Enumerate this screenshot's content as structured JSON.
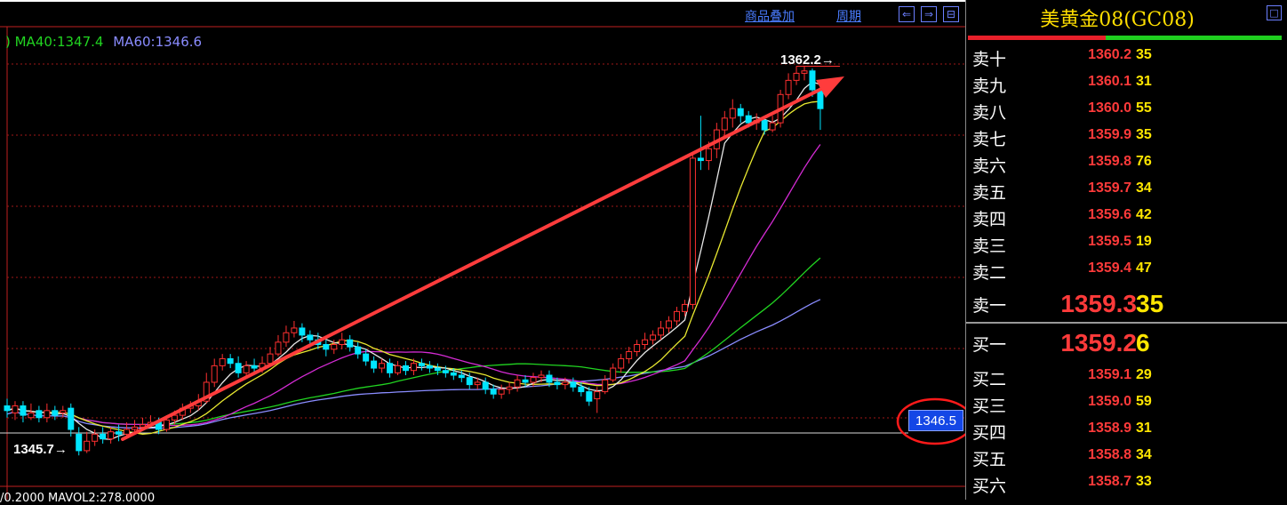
{
  "toolbar": {
    "overlay_label": "商品叠加",
    "period_label": "周期",
    "nav_buttons": [
      "⇐",
      "⇒",
      "⊟"
    ]
  },
  "ma_legend": [
    {
      "text": ") MA40:1347.4",
      "color": "#21d421"
    },
    {
      "text": "MA60:1346.6",
      "color": "#8a8cff"
    }
  ],
  "labels": {
    "high_price": "1362.2",
    "low_price": "1345.7",
    "cursor_price": "1346.5",
    "volume_line": "/0.2000  MAVOL2:278.0000"
  },
  "quote": {
    "title": "美黄金08(GC08)",
    "sell": [
      {
        "label": "卖十",
        "price": "1360.2",
        "vol": "35"
      },
      {
        "label": "卖九",
        "price": "1360.1",
        "vol": "31"
      },
      {
        "label": "卖八",
        "price": "1360.0",
        "vol": "55"
      },
      {
        "label": "卖七",
        "price": "1359.9",
        "vol": "35"
      },
      {
        "label": "卖六",
        "price": "1359.8",
        "vol": "76"
      },
      {
        "label": "卖五",
        "price": "1359.7",
        "vol": "34"
      },
      {
        "label": "卖四",
        "price": "1359.6",
        "vol": "42"
      },
      {
        "label": "卖三",
        "price": "1359.5",
        "vol": "19"
      },
      {
        "label": "卖二",
        "price": "1359.4",
        "vol": "47"
      },
      {
        "label": "卖一",
        "price": "1359.3",
        "vol": "35"
      }
    ],
    "buy": [
      {
        "label": "买一",
        "price": "1359.2",
        "vol": "6"
      },
      {
        "label": "买二",
        "price": "1359.1",
        "vol": "29"
      },
      {
        "label": "买三",
        "price": "1359.0",
        "vol": "59"
      },
      {
        "label": "买四",
        "price": "1358.9",
        "vol": "31"
      },
      {
        "label": "买五",
        "price": "1358.8",
        "vol": "34"
      },
      {
        "label": "买六",
        "price": "1358.7",
        "vol": "33"
      }
    ]
  },
  "colors": {
    "up": "#ff3030",
    "down": "#00e5ff",
    "ma5": "#e8e8e8",
    "ma10": "#e8e830",
    "ma20": "#d42bd4",
    "ma40": "#21d421",
    "ma60": "#8a8cff",
    "arrow": "#ff3c3c"
  },
  "chart_data": {
    "type": "candlestick",
    "price_range": [
      1344.2,
      1363.8
    ],
    "high": 1362.2,
    "low": 1345.7,
    "candles": [
      [
        1347.8,
        1347.6,
        1348.1,
        1347.3
      ],
      [
        1347.5,
        1347.8,
        1348.0,
        1347.2
      ],
      [
        1347.8,
        1347.4,
        1348.0,
        1347.1
      ],
      [
        1347.3,
        1347.5,
        1347.9,
        1347.2
      ],
      [
        1347.6,
        1347.3,
        1347.8,
        1347.1
      ],
      [
        1347.3,
        1347.6,
        1347.9,
        1347.1
      ],
      [
        1347.6,
        1347.4,
        1347.8,
        1347.2
      ],
      [
        1347.5,
        1347.6,
        1347.8,
        1347.3
      ],
      [
        1347.7,
        1346.8,
        1347.9,
        1346.5
      ],
      [
        1346.6,
        1345.9,
        1346.9,
        1345.7
      ],
      [
        1345.9,
        1346.3,
        1346.7,
        1345.8
      ],
      [
        1346.3,
        1346.6,
        1346.8,
        1346.1
      ],
      [
        1346.6,
        1346.4,
        1346.9,
        1346.2
      ],
      [
        1346.4,
        1346.7,
        1346.9,
        1346.2
      ],
      [
        1346.7,
        1346.6,
        1347.0,
        1346.3
      ],
      [
        1346.6,
        1346.8,
        1347.1,
        1346.4
      ],
      [
        1346.8,
        1346.9,
        1347.2,
        1346.6
      ],
      [
        1346.9,
        1347.0,
        1347.3,
        1346.8
      ],
      [
        1347.0,
        1347.1,
        1347.4,
        1346.9
      ],
      [
        1347.1,
        1346.8,
        1347.3,
        1346.6
      ],
      [
        1346.8,
        1347.2,
        1347.4,
        1346.7
      ],
      [
        1347.2,
        1347.4,
        1347.6,
        1347.0
      ],
      [
        1347.4,
        1347.7,
        1347.9,
        1347.2
      ],
      [
        1347.7,
        1347.8,
        1348.0,
        1347.5
      ],
      [
        1347.8,
        1348.0,
        1348.3,
        1347.6
      ],
      [
        1348.0,
        1348.8,
        1349.2,
        1347.9
      ],
      [
        1348.8,
        1349.5,
        1349.8,
        1348.6
      ],
      [
        1349.5,
        1349.8,
        1350.0,
        1349.3
      ],
      [
        1349.8,
        1349.6,
        1350.0,
        1349.4
      ],
      [
        1349.6,
        1349.2,
        1349.9,
        1349.0
      ],
      [
        1349.2,
        1349.5,
        1349.7,
        1349.0
      ],
      [
        1349.5,
        1349.4,
        1349.8,
        1349.2
      ],
      [
        1349.4,
        1349.6,
        1349.9,
        1349.2
      ],
      [
        1349.6,
        1350.0,
        1350.3,
        1349.5
      ],
      [
        1350.0,
        1350.5,
        1350.8,
        1349.9
      ],
      [
        1350.5,
        1350.9,
        1351.2,
        1350.3
      ],
      [
        1350.9,
        1351.1,
        1351.4,
        1350.7
      ],
      [
        1351.1,
        1350.8,
        1351.3,
        1350.5
      ],
      [
        1350.8,
        1350.6,
        1351.0,
        1350.3
      ],
      [
        1350.6,
        1350.4,
        1350.9,
        1350.2
      ],
      [
        1350.4,
        1350.2,
        1350.6,
        1349.9
      ],
      [
        1350.2,
        1350.4,
        1350.6,
        1350.0
      ],
      [
        1350.4,
        1350.6,
        1350.9,
        1350.2
      ],
      [
        1350.6,
        1350.3,
        1350.8,
        1350.1
      ],
      [
        1350.3,
        1350.0,
        1350.5,
        1349.8
      ],
      [
        1350.0,
        1349.7,
        1350.2,
        1349.5
      ],
      [
        1349.7,
        1349.4,
        1349.9,
        1349.2
      ],
      [
        1349.4,
        1349.6,
        1349.8,
        1349.2
      ],
      [
        1349.6,
        1349.2,
        1349.8,
        1349.0
      ],
      [
        1349.2,
        1349.5,
        1349.7,
        1349.1
      ],
      [
        1349.5,
        1349.3,
        1349.7,
        1349.1
      ],
      [
        1349.3,
        1349.6,
        1349.8,
        1349.1
      ],
      [
        1349.6,
        1349.5,
        1349.8,
        1349.3
      ],
      [
        1349.5,
        1349.4,
        1349.7,
        1349.2
      ],
      [
        1349.4,
        1349.3,
        1349.6,
        1349.1
      ],
      [
        1349.3,
        1349.2,
        1349.5,
        1349.0
      ],
      [
        1349.2,
        1349.1,
        1349.4,
        1348.9
      ],
      [
        1349.1,
        1349.0,
        1349.3,
        1348.8
      ],
      [
        1349.0,
        1348.7,
        1349.2,
        1348.5
      ],
      [
        1348.7,
        1348.8,
        1349.0,
        1348.5
      ],
      [
        1348.8,
        1348.5,
        1349.0,
        1348.3
      ],
      [
        1348.5,
        1348.3,
        1348.7,
        1348.1
      ],
      [
        1348.3,
        1348.5,
        1348.7,
        1348.1
      ],
      [
        1348.5,
        1348.6,
        1348.8,
        1348.3
      ],
      [
        1348.6,
        1348.9,
        1349.1,
        1348.4
      ],
      [
        1348.9,
        1348.8,
        1349.1,
        1348.6
      ],
      [
        1348.8,
        1349.0,
        1349.2,
        1348.6
      ],
      [
        1349.0,
        1349.1,
        1349.3,
        1348.8
      ],
      [
        1349.1,
        1348.8,
        1349.3,
        1348.6
      ],
      [
        1348.8,
        1348.7,
        1349.0,
        1348.5
      ],
      [
        1348.7,
        1348.8,
        1349.0,
        1348.5
      ],
      [
        1348.8,
        1348.6,
        1349.0,
        1348.4
      ],
      [
        1348.6,
        1348.4,
        1348.8,
        1348.2
      ],
      [
        1348.4,
        1348.0,
        1348.6,
        1347.8
      ],
      [
        1348.1,
        1348.4,
        1348.6,
        1347.5
      ],
      [
        1348.4,
        1348.9,
        1349.1,
        1348.3
      ],
      [
        1348.9,
        1349.4,
        1349.6,
        1348.8
      ],
      [
        1349.4,
        1349.8,
        1350.0,
        1349.2
      ],
      [
        1349.8,
        1350.1,
        1350.3,
        1349.6
      ],
      [
        1350.1,
        1350.4,
        1350.6,
        1349.9
      ],
      [
        1350.4,
        1350.6,
        1350.9,
        1350.2
      ],
      [
        1350.6,
        1350.8,
        1351.0,
        1350.4
      ],
      [
        1350.8,
        1351.1,
        1351.4,
        1350.6
      ],
      [
        1351.1,
        1351.4,
        1351.6,
        1350.9
      ],
      [
        1351.4,
        1351.8,
        1352.0,
        1351.2
      ],
      [
        1351.8,
        1352.1,
        1352.3,
        1351.6
      ],
      [
        1352.1,
        1358.3,
        1358.5,
        1351.9
      ],
      [
        1358.3,
        1358.2,
        1360.1,
        1357.8
      ],
      [
        1358.2,
        1358.7,
        1359.0,
        1357.8
      ],
      [
        1358.7,
        1359.5,
        1359.8,
        1358.3
      ],
      [
        1359.5,
        1360.0,
        1360.3,
        1359.2
      ],
      [
        1360.0,
        1360.4,
        1360.8,
        1359.6
      ],
      [
        1360.4,
        1360.1,
        1360.6,
        1359.8
      ],
      [
        1360.1,
        1359.8,
        1360.3,
        1359.6
      ],
      [
        1359.8,
        1359.9,
        1360.2,
        1359.5
      ],
      [
        1359.9,
        1359.5,
        1360.1,
        1359.3
      ],
      [
        1359.5,
        1359.8,
        1360.1,
        1359.4
      ],
      [
        1359.8,
        1361.0,
        1361.2,
        1359.6
      ],
      [
        1361.0,
        1361.6,
        1361.9,
        1360.8
      ],
      [
        1361.6,
        1361.9,
        1362.2,
        1361.4
      ],
      [
        1361.9,
        1362.0,
        1362.2,
        1361.6
      ],
      [
        1362.0,
        1361.2,
        1362.1,
        1360.9
      ],
      [
        1361.2,
        1360.4,
        1361.4,
        1359.5
      ]
    ],
    "ma5": [
      1347.6,
      1347.5,
      1347.4,
      1347.1,
      1346.8,
      1346.6,
      1346.5,
      1346.6,
      1346.7,
      1346.9,
      1347.1,
      1347.4,
      1347.8,
      1348.3,
      1348.9,
      1349.3,
      1349.6,
      1349.7,
      1349.8,
      1350.0,
      1350.3,
      1350.6,
      1350.8,
      1350.9,
      1350.8,
      1350.6,
      1350.4,
      1350.2,
      1350.0,
      1349.8,
      1349.6,
      1349.5,
      1349.4,
      1349.3,
      1349.2,
      1349.0,
      1348.9,
      1348.7,
      1348.6,
      1348.6,
      1348.7,
      1348.8,
      1348.9,
      1348.9,
      1348.8,
      1348.6,
      1348.5,
      1348.6,
      1348.9,
      1349.3,
      1349.7,
      1350.1,
      1350.5,
      1350.9,
      1351.4,
      1353.0,
      1354.9,
      1356.8,
      1358.6,
      1359.6,
      1359.9,
      1360.0,
      1360.0,
      1360.1,
      1360.5,
      1361.0,
      1361.2
    ],
    "ma10": [
      1347.4,
      1347.2,
      1347.0,
      1346.9,
      1346.8,
      1346.8,
      1346.9,
      1347.0,
      1347.2,
      1347.5,
      1347.9,
      1348.3,
      1348.7,
      1349.0,
      1349.3,
      1349.5,
      1349.7,
      1349.8,
      1349.9,
      1349.9,
      1349.9,
      1349.9,
      1349.8,
      1349.7,
      1349.6,
      1349.5,
      1349.4,
      1349.3,
      1349.2,
      1349.1,
      1349.0,
      1348.9,
      1348.9,
      1348.8,
      1348.8,
      1348.8,
      1348.8,
      1348.7,
      1348.7,
      1348.8,
      1348.9,
      1349.0,
      1349.2,
      1349.4,
      1349.7,
      1350.0,
      1350.6,
      1351.5,
      1352.6,
      1353.8,
      1355.0,
      1356.1,
      1357.3,
      1358.2,
      1358.9,
      1359.3,
      1359.7
    ]
  }
}
